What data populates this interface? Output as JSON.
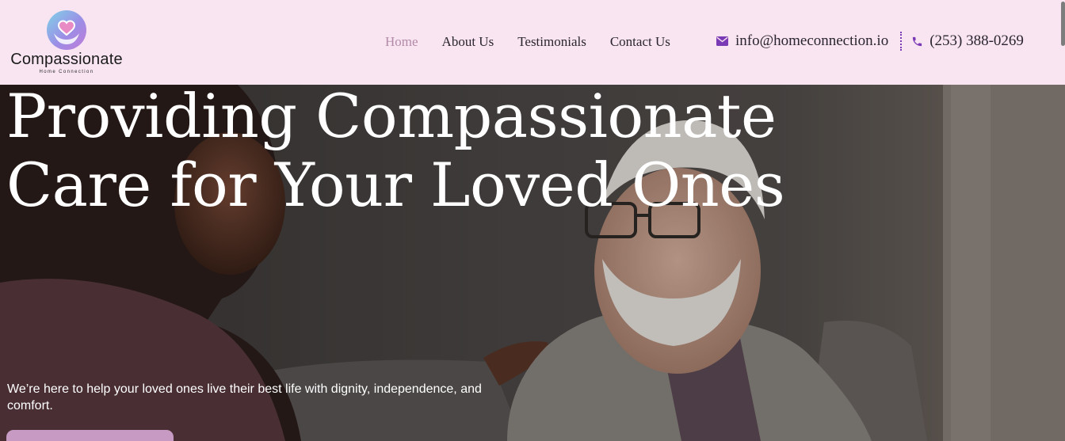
{
  "brand": {
    "name": "Compassionate",
    "tagline": "Home Connection",
    "logo_icon": "heart-hands-icon"
  },
  "nav": {
    "items": [
      {
        "label": "Home",
        "active": true
      },
      {
        "label": "About Us",
        "active": false
      },
      {
        "label": "Testimonials",
        "active": false
      },
      {
        "label": "Contact Us",
        "active": false
      }
    ]
  },
  "contact": {
    "email": "info@homeconnection.io",
    "email_icon": "envelope-icon",
    "phone": "(253) 388-0269",
    "phone_icon": "phone-icon"
  },
  "hero": {
    "title": "Providing Compassionate Care for Your Loved Ones",
    "subtitle": "We’re here to help your loved ones live their best life with dignity, independence, and comfort."
  },
  "colors": {
    "header_bg": "#f8e5f1",
    "nav_active": "#b28aa8",
    "accent": "#7b3ab5",
    "cta_bg": "#c79ac4"
  }
}
